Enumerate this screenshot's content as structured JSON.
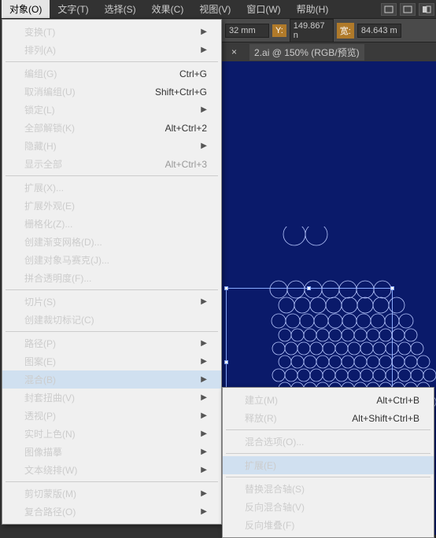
{
  "menubar": {
    "items": [
      "对象(O)",
      "文字(T)",
      "选择(S)",
      "效果(C)",
      "视图(V)",
      "窗口(W)",
      "帮助(H)"
    ]
  },
  "dropdown": {
    "groups": [
      [
        {
          "label": "变换(T)",
          "arrow": true
        },
        {
          "label": "排列(A)",
          "arrow": true
        }
      ],
      [
        {
          "label": "编组(G)",
          "shortcut": "Ctrl+G"
        },
        {
          "label": "取消编组(U)",
          "shortcut": "Shift+Ctrl+G"
        },
        {
          "label": "锁定(L)",
          "arrow": true
        },
        {
          "label": "全部解锁(K)",
          "shortcut": "Alt+Ctrl+2"
        },
        {
          "label": "隐藏(H)",
          "arrow": true
        },
        {
          "label": "显示全部",
          "shortcut": "Alt+Ctrl+3",
          "disabled": true
        }
      ],
      [
        {
          "label": "扩展(X)..."
        },
        {
          "label": "扩展外观(E)",
          "disabled": true
        },
        {
          "label": "栅格化(Z)..."
        },
        {
          "label": "创建渐变网格(D)...",
          "disabled": true
        },
        {
          "label": "创建对象马赛克(J)...",
          "disabled": true
        },
        {
          "label": "拼合透明度(F)..."
        }
      ],
      [
        {
          "label": "切片(S)",
          "arrow": true
        },
        {
          "label": "创建裁切标记(C)"
        }
      ],
      [
        {
          "label": "路径(P)",
          "arrow": true
        },
        {
          "label": "图案(E)",
          "arrow": true
        },
        {
          "label": "混合(B)",
          "arrow": true,
          "highlighted": true
        },
        {
          "label": "封套扭曲(V)",
          "arrow": true
        },
        {
          "label": "透视(P)",
          "arrow": true
        },
        {
          "label": "实时上色(N)",
          "arrow": true
        },
        {
          "label": "图像描摹",
          "arrow": true
        },
        {
          "label": "文本绕排(W)",
          "arrow": true
        }
      ],
      [
        {
          "label": "剪切蒙版(M)",
          "arrow": true
        },
        {
          "label": "复合路径(O)",
          "arrow": true
        }
      ]
    ]
  },
  "submenu": {
    "items": [
      {
        "label": "建立(M)",
        "shortcut": "Alt+Ctrl+B"
      },
      {
        "label": "释放(R)",
        "shortcut": "Alt+Shift+Ctrl+B"
      },
      {
        "sep": true
      },
      {
        "label": "混合选项(O)..."
      },
      {
        "sep": true
      },
      {
        "label": "扩展(E)",
        "highlighted": true
      },
      {
        "sep": true
      },
      {
        "label": "替换混合轴(S)",
        "disabled": true
      },
      {
        "label": "反向混合轴(V)"
      },
      {
        "label": "反向堆叠(F)"
      }
    ]
  },
  "options": {
    "x_suffix": "32 mm",
    "y_label": "Y:",
    "y_value": "149.867 n",
    "w_label": "宽:",
    "w_value": "84.643 m"
  },
  "tabs": {
    "tab1_close": "×",
    "tab2": "2.ai @ 150% (RGB/预览)"
  }
}
